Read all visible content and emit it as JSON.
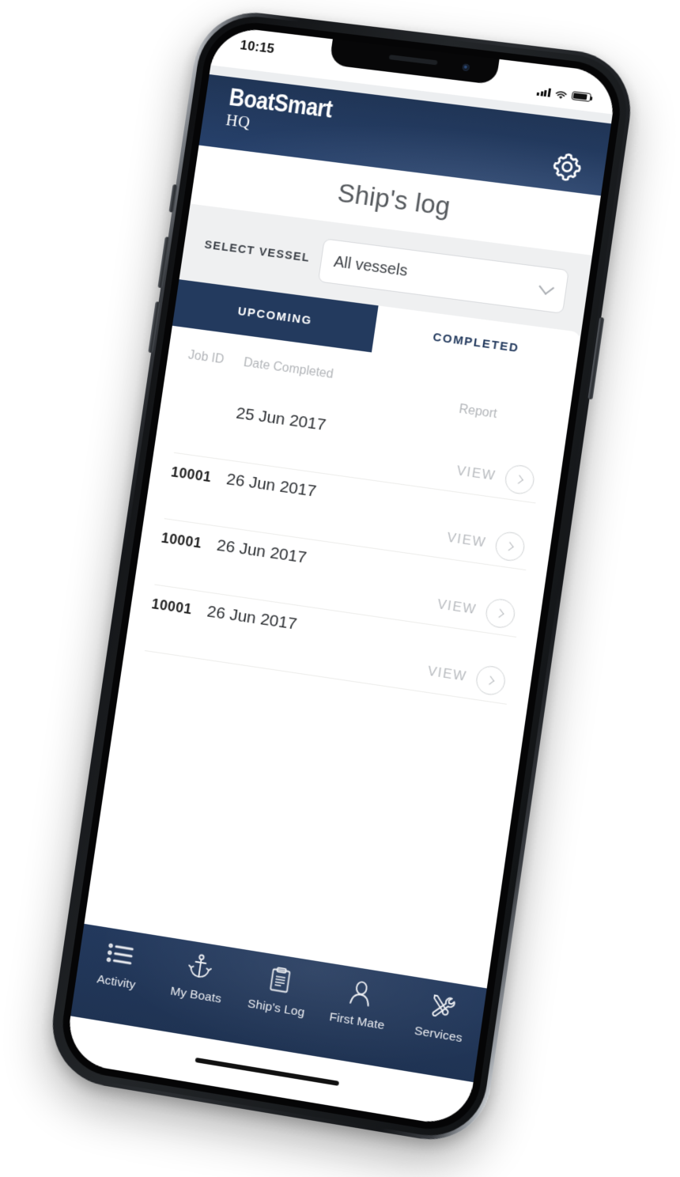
{
  "status_bar": {
    "time": "10:15",
    "signal_icon": "cellular-signal-icon",
    "wifi_icon": "wifi-icon",
    "battery_icon": "battery-icon"
  },
  "header": {
    "brand_primary": "BoatSmart",
    "brand_secondary": "HQ",
    "settings_icon": "gear-icon",
    "background_color": "#233a5e"
  },
  "page": {
    "title": "Ship's log"
  },
  "vessel_selector": {
    "label": "SELECT VESSEL",
    "selected_value": "All vessels",
    "placeholder": "All vessels",
    "chevron_icon": "chevron-down-icon",
    "options": [
      "All vessels"
    ]
  },
  "tabs": [
    {
      "label": "UPCOMING",
      "active": true
    },
    {
      "label": "COMPLETED",
      "active": false
    }
  ],
  "table": {
    "columns": {
      "job_id": "Job ID",
      "date_completed": "Date Completed",
      "report": "Report"
    },
    "rows": [
      {
        "job_id": "",
        "date": "25 Jun 2017",
        "action": "VIEW",
        "action_icon": "chevron-right-circle-icon"
      },
      {
        "job_id": "10001",
        "date": "26 Jun 2017",
        "action": "VIEW",
        "action_icon": "chevron-right-circle-icon"
      },
      {
        "job_id": "10001",
        "date": "26 Jun 2017",
        "action": "VIEW",
        "action_icon": "chevron-right-circle-icon"
      },
      {
        "job_id": "10001",
        "date": "26 Jun 2017",
        "action": "VIEW",
        "action_icon": "chevron-right-circle-icon"
      }
    ]
  },
  "bottom_nav": [
    {
      "label": "Activity",
      "icon": "list-icon",
      "active": false
    },
    {
      "label": "My Boats",
      "icon": "anchor-icon",
      "active": false
    },
    {
      "label": "Ship's Log",
      "icon": "clipboard-icon",
      "active": true
    },
    {
      "label": "First Mate",
      "icon": "person-icon",
      "active": false
    },
    {
      "label": "Services",
      "icon": "tools-icon",
      "active": false
    }
  ],
  "colors": {
    "navy": "#233a5e",
    "page_background": "#eff0f1",
    "muted_text": "#b2b5b9"
  }
}
